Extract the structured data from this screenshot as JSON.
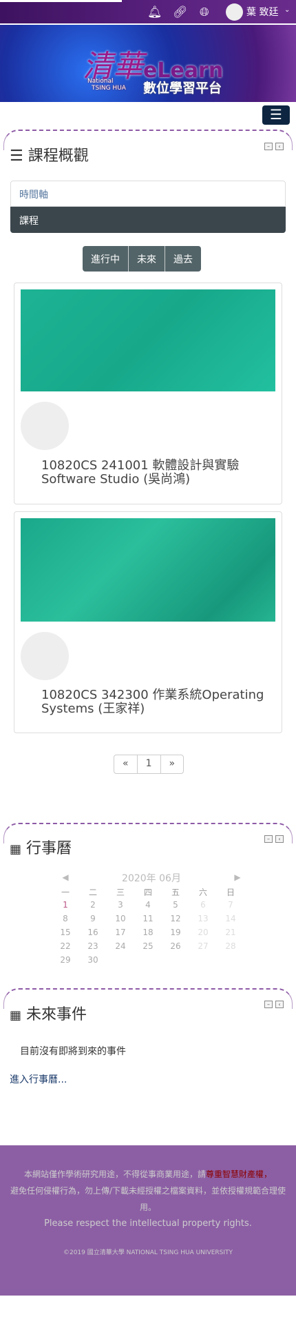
{
  "header": {
    "user_name": "葉 致廷",
    "icons": [
      "bell-icon",
      "link-icon",
      "globe-icon"
    ]
  },
  "banner": {
    "logo_cn": "清華",
    "logo_en_1": "National",
    "logo_en_2": "TSING HUA",
    "logo_elearn": "eLearn",
    "logo_sub": "數位學習平台"
  },
  "course_overview": {
    "title": "課程概觀",
    "views": [
      "時間軸",
      "課程"
    ],
    "filters": [
      "進行中",
      "未來",
      "過去"
    ],
    "courses": [
      {
        "title": "10820CS 241001 軟體設計與實驗Software Studio (吳尚鴻)"
      },
      {
        "title": "10820CS 342300 作業系統Operating Systems (王家祥)"
      }
    ],
    "pagination": {
      "prev": "«",
      "page": "1",
      "next": "»"
    }
  },
  "calendar": {
    "title": "行事曆",
    "month": "2020年 06月",
    "prev": "◀",
    "next": "▶",
    "weekdays": [
      "一",
      "二",
      "三",
      "四",
      "五",
      "六",
      "日"
    ],
    "days": [
      "1",
      "2",
      "3",
      "4",
      "5",
      "6",
      "7",
      "8",
      "9",
      "10",
      "11",
      "12",
      "13",
      "14",
      "15",
      "16",
      "17",
      "18",
      "19",
      "20",
      "21",
      "22",
      "23",
      "24",
      "25",
      "26",
      "27",
      "28",
      "29",
      "30"
    ]
  },
  "upcoming": {
    "title": "未來事件",
    "empty": "目前沒有即將到來的事件",
    "link": "進入行事曆..."
  },
  "footer": {
    "line1": "本網站僅作學術研究用途，不得從事商業用途，請",
    "line1_emph": "尊重智慧財產權，",
    "line2": "避免任何侵權行為，勿上傳/下載未經授權之檔案資料，並依授權規範合理使用。",
    "line3": "Please respect the intellectual property rights.",
    "copyright": "©2019 國立清華大學 NATIONAL TSING HUA UNIVERSITY"
  },
  "colors": {
    "topbar": "#4a1a6a",
    "footer": "#8c5fa4",
    "accent": "#8d5aa6",
    "course_image": "#1db394"
  }
}
